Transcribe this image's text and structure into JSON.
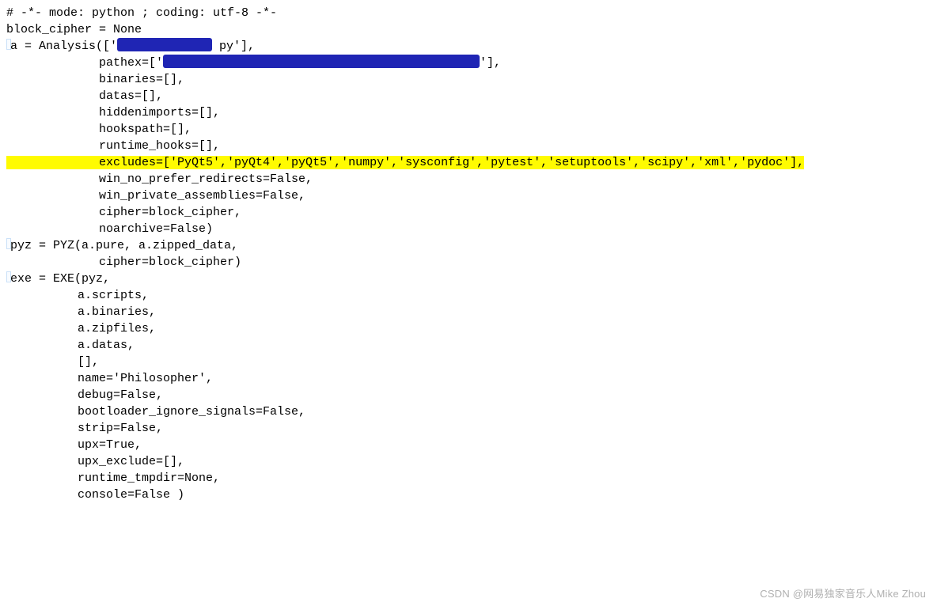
{
  "code": {
    "l1": "# -*- mode: python ; coding: utf-8 -*-",
    "l2": "",
    "l3": "block_cipher = None",
    "l4": "",
    "l5": "",
    "l6p1": "a = Analysis(['",
    "l6p2": " py'],",
    "l7p1": "             pathex=['",
    "l7p2": "'],",
    "l8": "             binaries=[],",
    "l9": "             datas=[],",
    "l10": "             hiddenimports=[],",
    "l11": "             hookspath=[],",
    "l12": "             runtime_hooks=[],",
    "l13": "             excludes=['PyQt5','pyQt4','pyQt5','numpy','sysconfig','pytest','setuptools','scipy','xml','pydoc'],",
    "l14": "             win_no_prefer_redirects=False,",
    "l15": "             win_private_assemblies=False,",
    "l16": "             cipher=block_cipher,",
    "l17": "             noarchive=False)",
    "l18": "pyz = PYZ(a.pure, a.zipped_data,",
    "l19": "             cipher=block_cipher)",
    "l20": "exe = EXE(pyz,",
    "l21": "          a.scripts,",
    "l22": "          a.binaries,",
    "l23": "          a.zipfiles,",
    "l24": "          a.datas,",
    "l25": "          [],",
    "l26": "          name='Philosopher',",
    "l27": "          debug=False,",
    "l28": "          bootloader_ignore_signals=False,",
    "l29": "          strip=False,",
    "l30": "          upx=True,",
    "l31": "          upx_exclude=[],",
    "l32": "          runtime_tmpdir=None,",
    "l33": "          console=False )"
  },
  "watermark": "CSDN @网易独家音乐人Mike Zhou"
}
